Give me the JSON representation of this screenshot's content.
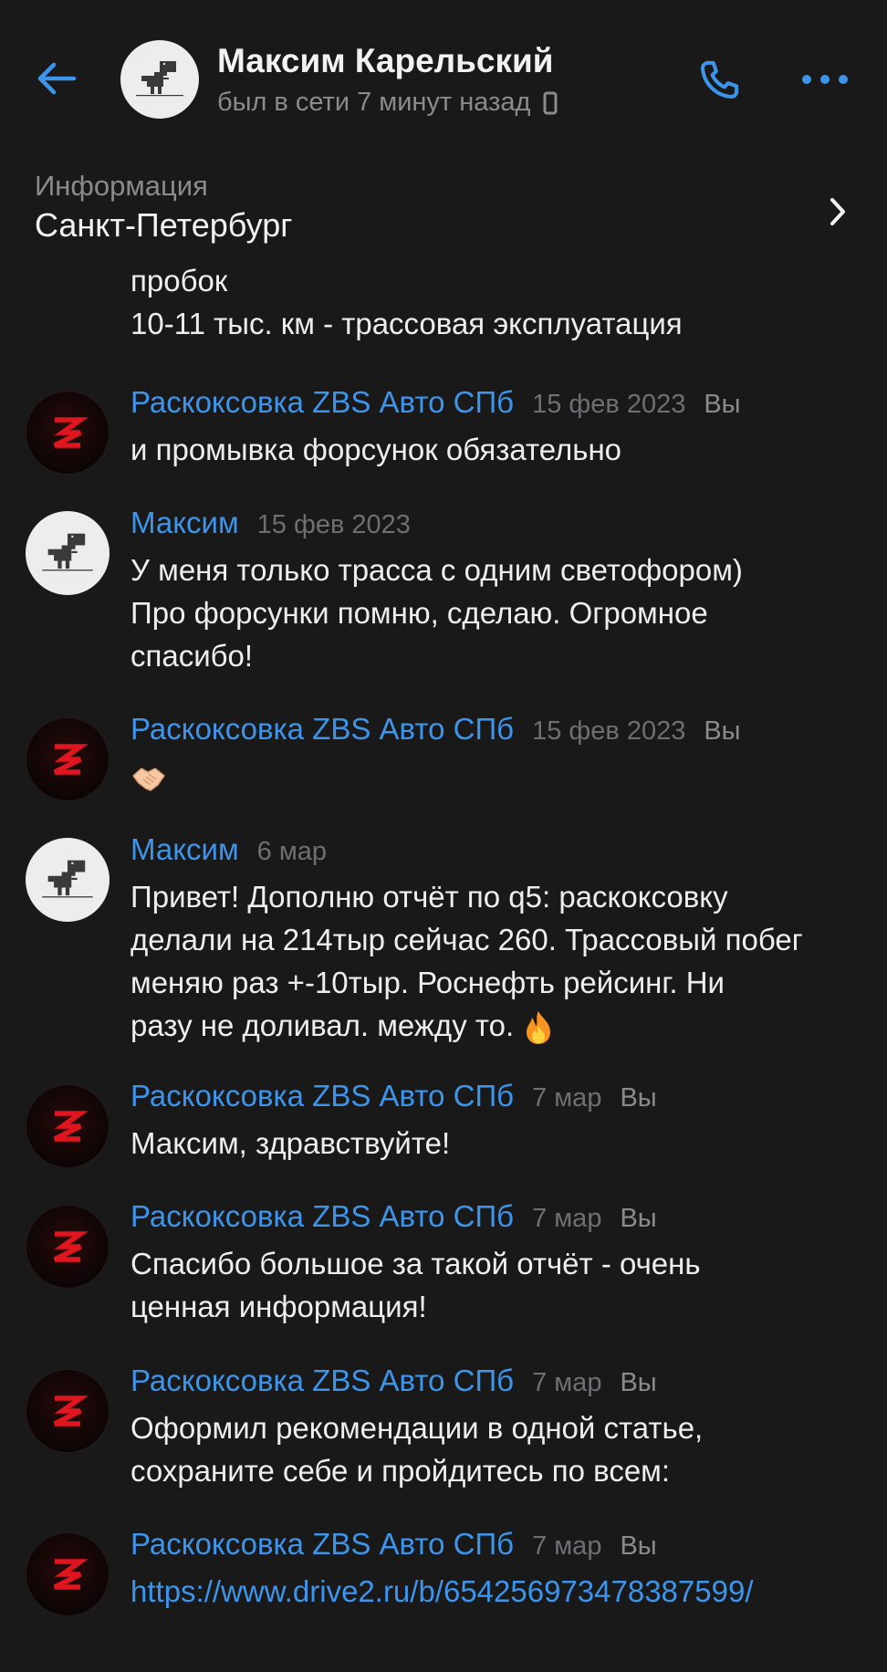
{
  "header": {
    "name": "Максим Карельский",
    "status": "был в сети 7 минут назад",
    "back_icon": "arrow-left-icon",
    "phone_icon": "phone-icon",
    "more_icon": "more-horizontal-icon",
    "accent": "#3c95ea"
  },
  "info": {
    "title": "Информация",
    "value": "Санкт-Петербург"
  },
  "continuation": {
    "lines": [
      "пробок",
      "10-11 тыс. км - трассовая эксплуатация"
    ]
  },
  "messages": [
    {
      "author": "Раскоксовка ZBS Авто СПб",
      "date": "15 фев 2023",
      "you": "Вы",
      "lines": [
        "и промывка форсунок обязательно"
      ]
    },
    {
      "author": "Максим",
      "date": "15 фев 2023",
      "lines": [
        "У меня только трасса с одним светофором)",
        "Про форсунки помню, сделаю. Огромное",
        "спасибо!"
      ]
    },
    {
      "author": "Раскоксовка ZBS Авто СПб",
      "date": "15 фев 2023",
      "you": "Вы",
      "emoji": "handshake-emoji"
    },
    {
      "author": "Максим",
      "date": "6 мар",
      "lines": [
        "Привет! Дополню отчёт по q5: раскоксовку",
        "делали на 214тыр сейчас 260. Трассовый побег",
        "меняю раз +-10тыр. Роснефть рейсинг. Ни",
        "разу не доливал. между то."
      ],
      "trailing_emoji": "fire-emoji"
    },
    {
      "author": "Раскоксовка ZBS Авто СПб",
      "date": "7 мар",
      "you": "Вы",
      "lines": [
        "Максим, здравствуйте!"
      ]
    },
    {
      "author": "Раскоксовка ZBS Авто СПб",
      "date": "7 мар",
      "you": "Вы",
      "lines": [
        "Спасибо большое за такой отчёт - очень",
        "ценная информация!"
      ]
    },
    {
      "author": "Раскоксовка ZBS Авто СПб",
      "date": "7 мар",
      "you": "Вы",
      "lines": [
        "Оформил рекомендации в одной статье,",
        "сохраните себе и пройдитесь по всем:"
      ]
    },
    {
      "author": "Раскоксовка ZBS Авто СПб",
      "date": "7 мар",
      "you": "Вы",
      "link": "https://www.drive2.ru/b/654256973478387599/"
    }
  ]
}
